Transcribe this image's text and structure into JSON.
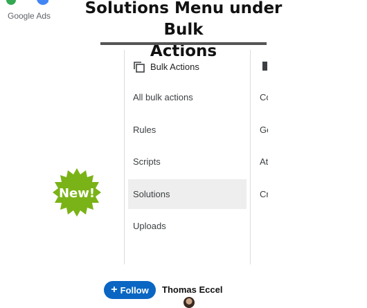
{
  "logo": {
    "text": "Google Ads",
    "colors": [
      "#34A853",
      "#4285F4",
      "#FBBC04"
    ]
  },
  "title": {
    "line1": "Solutions Menu under Bulk",
    "line2": "Actions"
  },
  "menu": {
    "header_icon": "copy-stack-icon",
    "header": "Bulk Actions",
    "items": [
      {
        "label": "All bulk actions",
        "active": false
      },
      {
        "label": "Rules",
        "active": false
      },
      {
        "label": "Scripts",
        "active": false
      },
      {
        "label": "Solutions",
        "active": true
      },
      {
        "label": "Uploads",
        "active": false
      }
    ]
  },
  "right_panel_peek": [
    "Co",
    "Go",
    "At",
    "Cr"
  ],
  "badge": {
    "text": "New!",
    "color": "#7ab317"
  },
  "footer": {
    "follow_label": "Follow",
    "author": "Thomas Eccel",
    "button_color": "#0a66c2"
  }
}
